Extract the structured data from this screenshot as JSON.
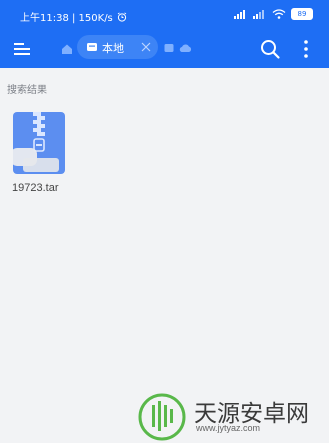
{
  "status_bar": {
    "time_speed": "上午11:38 | 150K/s",
    "battery": "89"
  },
  "toolbar": {
    "location_label": "本地"
  },
  "section": {
    "title": "搜索结果"
  },
  "files": [
    {
      "name": "19723.tar",
      "icon": "zip-archive-icon"
    }
  ],
  "watermark": {
    "title": "天源安卓网",
    "url": "www.jytyaz.com"
  },
  "colors": {
    "primary": "#1e6ef4",
    "chip": "#3d84f6",
    "background": "#f2f3f5",
    "file_icon": "#5c8ef0"
  }
}
